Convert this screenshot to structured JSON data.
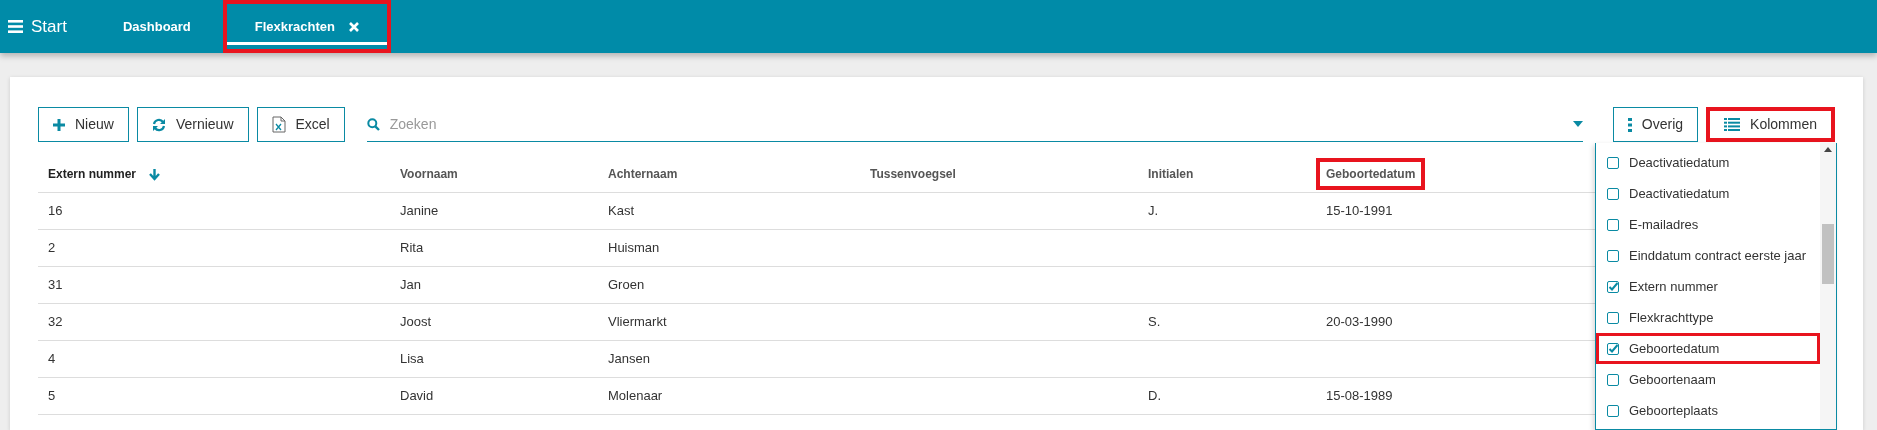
{
  "app_bar": {
    "brand": "Start",
    "tabs": [
      {
        "label": "Dashboard",
        "selected": false,
        "closable": false,
        "highlighted": false
      },
      {
        "label": "Flexkrachten",
        "selected": true,
        "closable": true,
        "highlighted": true
      }
    ]
  },
  "toolbar": {
    "buttons": [
      {
        "label": "Nieuw",
        "kind": "plus"
      },
      {
        "label": "Vernieuw",
        "kind": "refresh"
      },
      {
        "label": "Excel",
        "kind": "excel"
      }
    ],
    "search": {
      "placeholder": "Zoeken"
    },
    "right_buttons": [
      {
        "label": "Overig",
        "kind": "dots",
        "highlighted": false
      },
      {
        "label": "Kolommen",
        "kind": "list",
        "highlighted": true
      }
    ]
  },
  "table": {
    "columns": [
      {
        "label": "Extern nummer",
        "sorted": true,
        "highlighted": false
      },
      {
        "label": "Voornaam",
        "sorted": false,
        "highlighted": false
      },
      {
        "label": "Achternaam",
        "sorted": false,
        "highlighted": false
      },
      {
        "label": "Tussenvoegsel",
        "sorted": false,
        "highlighted": false
      },
      {
        "label": "Initialen",
        "sorted": false,
        "highlighted": false
      },
      {
        "label": "Geboortedatum",
        "sorted": false,
        "highlighted": true
      }
    ],
    "rows": [
      [
        "16",
        "Janine",
        "Kast",
        "",
        "J.",
        "15-10-1991"
      ],
      [
        "2",
        "Rita",
        "Huisman",
        "",
        "",
        ""
      ],
      [
        "31",
        "Jan",
        "Groen",
        "",
        "",
        ""
      ],
      [
        "32",
        "Joost",
        "Vliermarkt",
        "",
        "S.",
        "20-03-1990"
      ],
      [
        "4",
        "Lisa",
        "Jansen",
        "",
        "",
        ""
      ],
      [
        "5",
        "David",
        "Molenaar",
        "",
        "D.",
        "15-08-1989"
      ]
    ]
  },
  "columns_menu": {
    "items": [
      {
        "label": "Deactivatiedatum",
        "checked": false,
        "highlighted": false
      },
      {
        "label": "Deactivatiedatum",
        "checked": false,
        "highlighted": false
      },
      {
        "label": "E-mailadres",
        "checked": false,
        "highlighted": false
      },
      {
        "label": "Einddatum contract eerste jaar",
        "checked": false,
        "highlighted": false
      },
      {
        "label": "Extern nummer",
        "checked": true,
        "highlighted": false
      },
      {
        "label": "Flexkrachttype",
        "checked": false,
        "highlighted": false
      },
      {
        "label": "Geboortedatum",
        "checked": true,
        "highlighted": true
      },
      {
        "label": "Geboortenaam",
        "checked": false,
        "highlighted": false
      },
      {
        "label": "Geboorteplaats",
        "checked": false,
        "highlighted": false
      }
    ]
  }
}
